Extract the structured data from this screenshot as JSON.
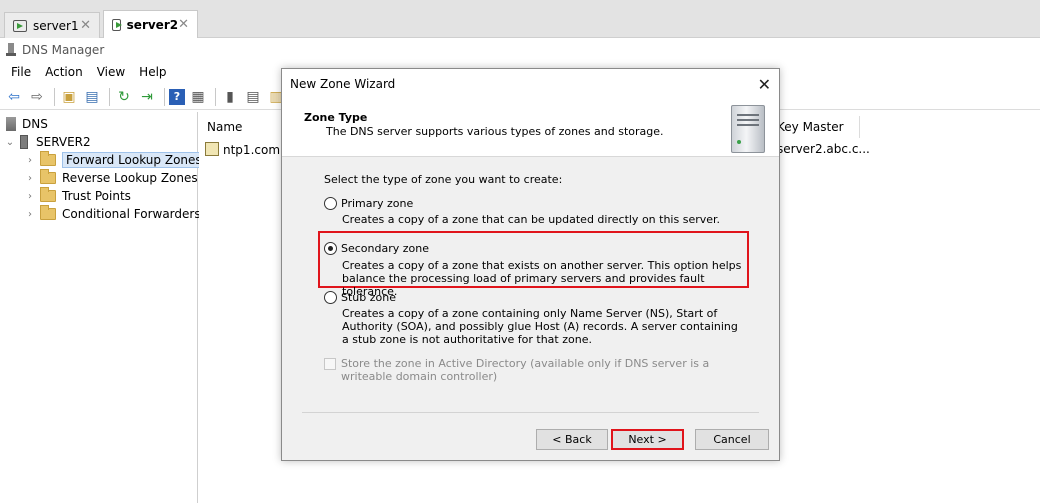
{
  "tabs": [
    {
      "label": "server1",
      "close": "✕"
    },
    {
      "label": "server2",
      "close": "✕"
    }
  ],
  "app": {
    "title": "DNS Manager"
  },
  "menu": [
    "File",
    "Action",
    "View",
    "Help"
  ],
  "tree": {
    "root": "DNS",
    "server": "SERVER2",
    "items": [
      "Forward Lookup Zones",
      "Reverse Lookup Zones",
      "Trust Points",
      "Conditional Forwarders"
    ]
  },
  "results": {
    "columns": [
      "Name",
      "Key Master"
    ],
    "rows": [
      {
        "name": "ntp1.com",
        "key_master": "server2.abc.c..."
      }
    ]
  },
  "dialog": {
    "title": "New Zone Wizard",
    "header_title": "Zone Type",
    "header_subtitle": "The DNS server supports various types of zones and storage.",
    "prompt": "Select the type of zone you want to create:",
    "options": [
      {
        "label": "Primary zone",
        "description": "Creates a copy of a zone that can be updated directly on this server.",
        "checked": false
      },
      {
        "label": "Secondary zone",
        "description": "Creates a copy of a zone that exists on another server. This option helps balance the processing load of primary servers and provides fault tolerance.",
        "checked": true
      },
      {
        "label": "Stub zone",
        "description": "Creates a copy of a zone containing only Name Server (NS), Start of Authority (SOA), and possibly glue Host (A) records. A server containing a stub zone is not authoritative for that zone.",
        "checked": false
      }
    ],
    "store_ad_label": "Store the zone in Active Directory (available only if DNS server is a writeable domain controller)",
    "buttons": {
      "back": "< Back",
      "next": "Next >",
      "cancel": "Cancel"
    }
  },
  "colors": {
    "highlight": "#e0141b",
    "selection": "#d9e7f7"
  }
}
